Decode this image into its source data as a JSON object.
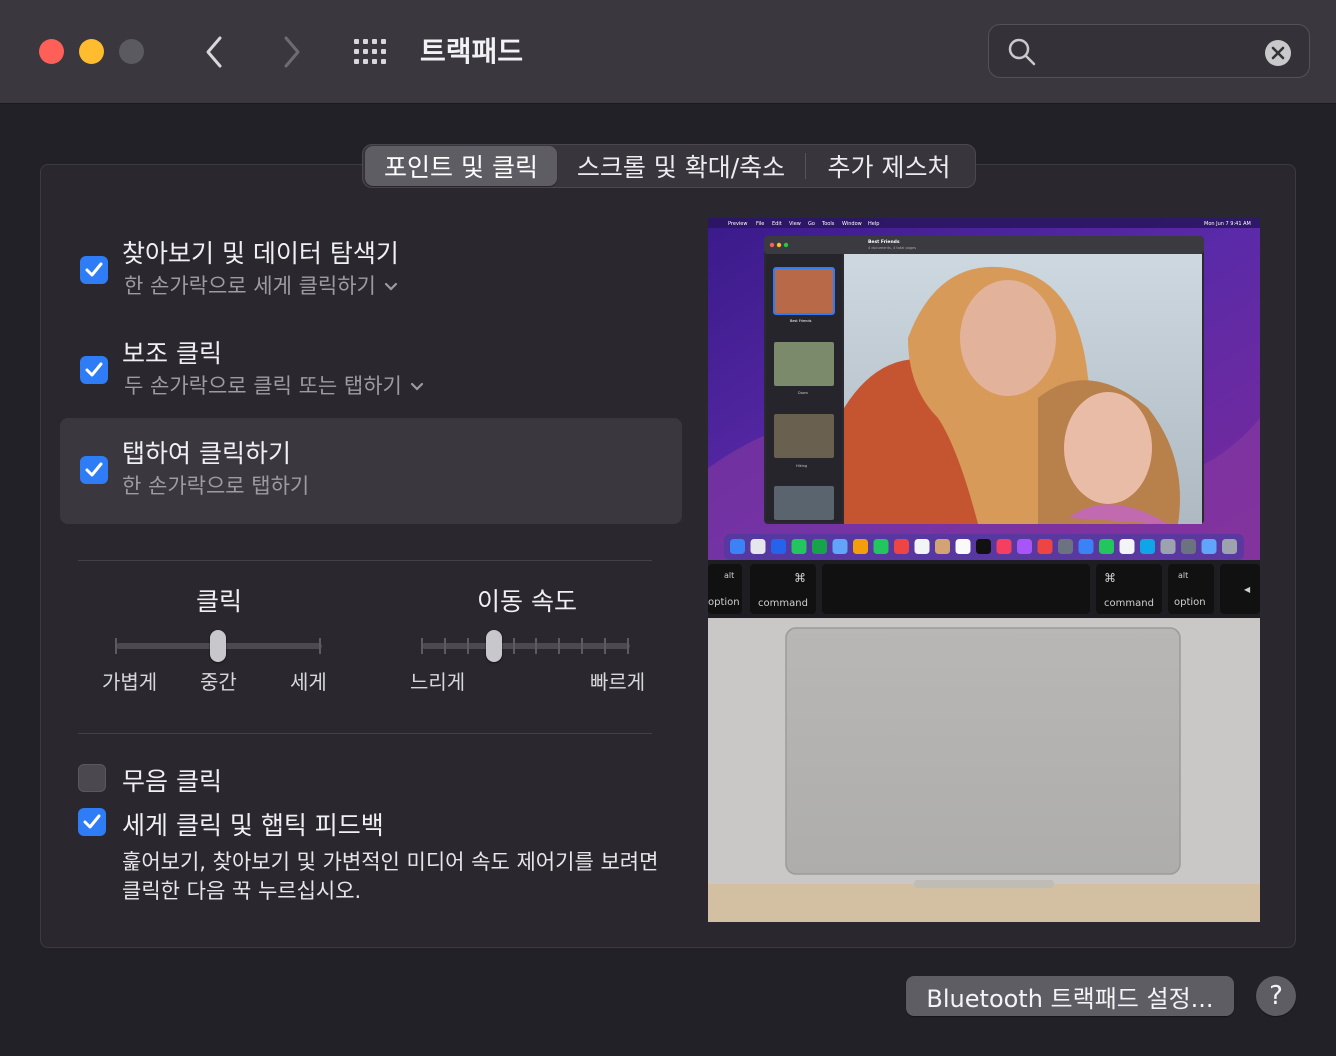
{
  "window": {
    "title": "트랙패드",
    "search_placeholder": "",
    "icons": [
      "chevron-left-icon",
      "chevron-right-icon",
      "grid-icon",
      "search-icon",
      "clear-icon"
    ]
  },
  "tabs": [
    {
      "label": "포인트 및 클릭",
      "active": true
    },
    {
      "label": "스크롤 및 확대/축소",
      "active": false
    },
    {
      "label": "추가 제스처",
      "active": false
    }
  ],
  "options": {
    "lookup": {
      "title": "찾아보기 및 데이터 탐색기",
      "sub": "한 손가락으로 세게 클릭하기",
      "checked": true
    },
    "secondary": {
      "title": "보조 클릭",
      "sub": "두 손가락으로 클릭 또는 탭하기",
      "checked": true
    },
    "tap": {
      "title": "탭하여 클릭하기",
      "sub": "한 손가락으로 탭하기",
      "checked": true
    }
  },
  "click_slider": {
    "title": "클릭",
    "labels": [
      "가볍게",
      "중간",
      "세게"
    ],
    "value_index": 1,
    "positions": 3
  },
  "speed_slider": {
    "title": "이동 속도",
    "min_label": "느리게",
    "max_label": "빠르게",
    "value_index": 3,
    "positions": 10
  },
  "silent_click": {
    "label": "무음 클릭",
    "checked": false
  },
  "force_click": {
    "label": "세게 클릭 및 햅틱 피드백",
    "checked": true,
    "desc_line1": "훑어보기, 찾아보기 및 가변적인 미디어 속도 제어기를 보려면",
    "desc_line2": "클릭한 다음 꾹 누르십시오."
  },
  "preview": {
    "menubar": {
      "app": "Preview",
      "items": [
        "File",
        "Edit",
        "View",
        "Go",
        "Tools",
        "Window",
        "Help"
      ],
      "clock": "Mon Jun 7  9:41 AM"
    },
    "doc_title": "Best Friends",
    "doc_subtitle": "4 documents, 4 total pages",
    "thumb_labels": [
      "Best Friends",
      "Dawn",
      "Hiking"
    ],
    "keys": {
      "alt": "alt",
      "option": "option",
      "command": "command",
      "cmd_symbol": "⌘",
      "arrow": "◀"
    }
  },
  "footer": {
    "bluetooth_button": "Bluetooth 트랙패드 설정...",
    "help_button": "?"
  }
}
